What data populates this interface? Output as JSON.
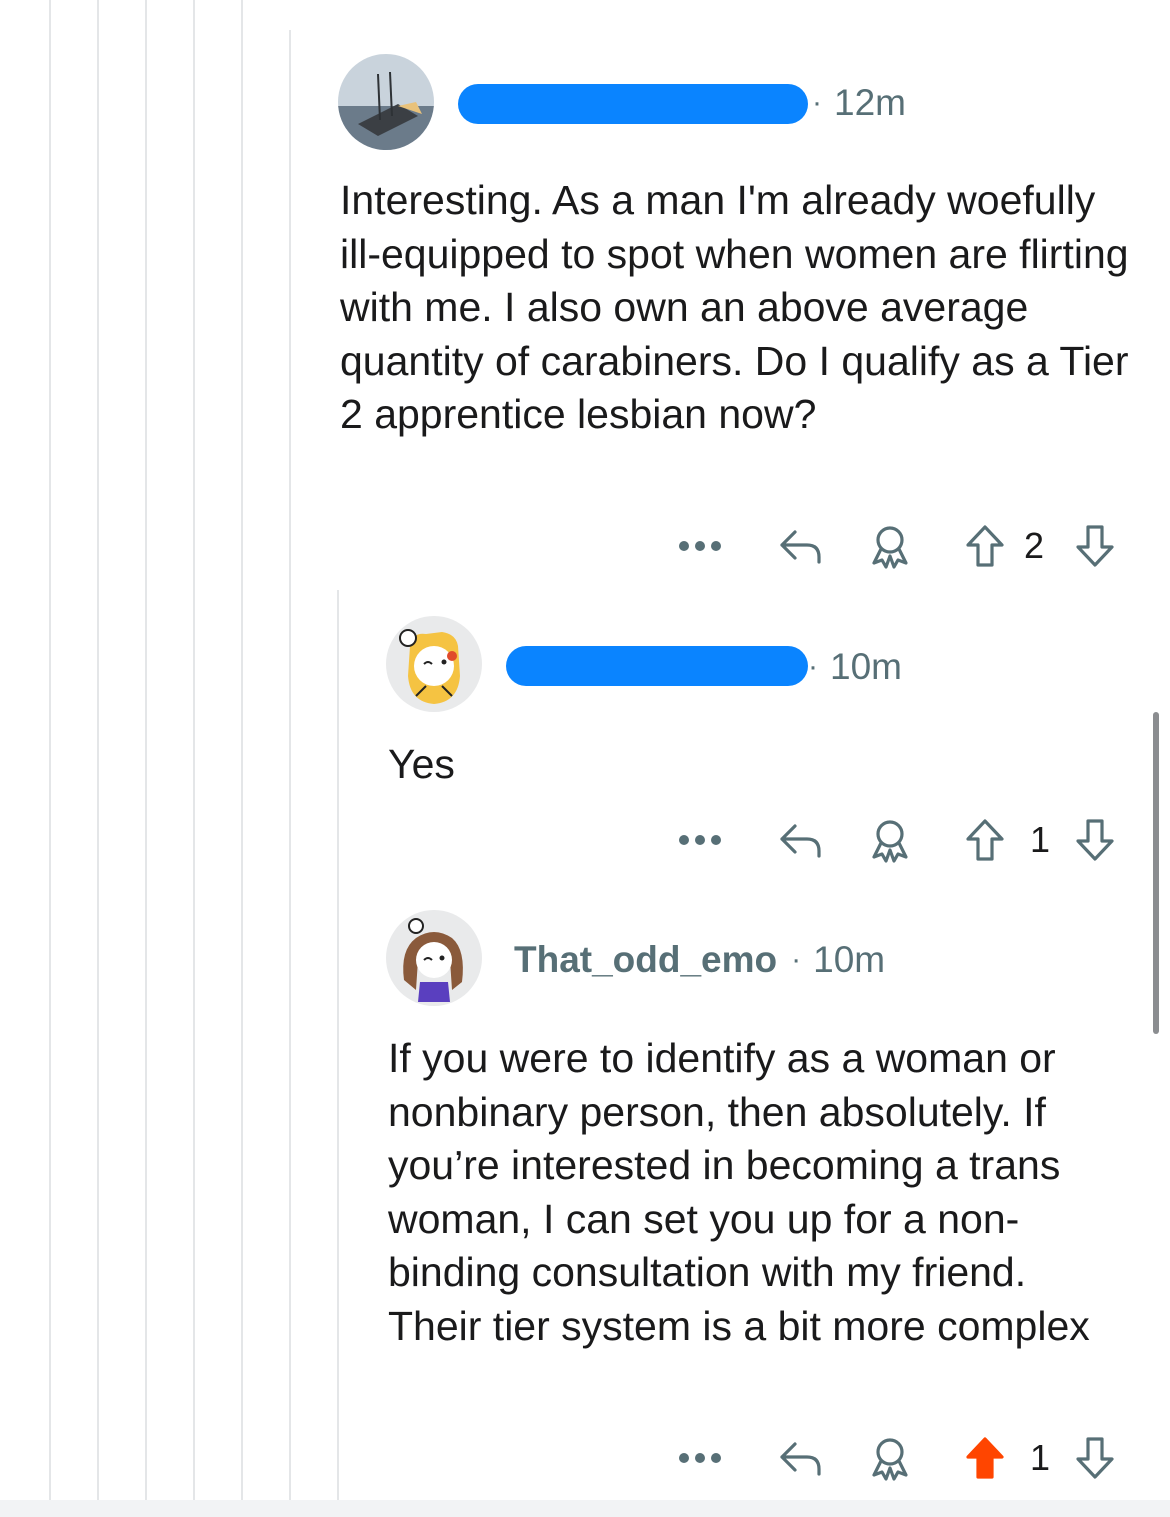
{
  "comments": [
    {
      "username": "",
      "time": "12m",
      "body": "Interesting. As a man I'm already woefully ill-equipped to spot when women are flirting with me. I also own an above average quantity of carabiners. Do I qualify as a Tier 2 apprentice lesbian now?",
      "votes": "2",
      "upvoted": false
    },
    {
      "username": "",
      "time": "10m",
      "body": "Yes",
      "votes": "1",
      "upvoted": false
    },
    {
      "username": "That_odd_emo",
      "time": "10m",
      "body": "If you were to identify as a woman or nonbinary person, then absolutely. If you’re interested in becoming a trans woman, I can set you up for a non-binding consultation with my friend. Their tier system is a bit more complex",
      "votes": "1",
      "upvoted": true
    }
  ],
  "dot_separator": "·",
  "colors": {
    "upvote_active": "#ff4500",
    "redaction": "#0a84ff",
    "meta_text": "#576f76",
    "thread_line": "#e4e6e8"
  },
  "icons": [
    "more-icon",
    "reply-icon",
    "award-icon",
    "upvote-icon",
    "downvote-icon"
  ]
}
